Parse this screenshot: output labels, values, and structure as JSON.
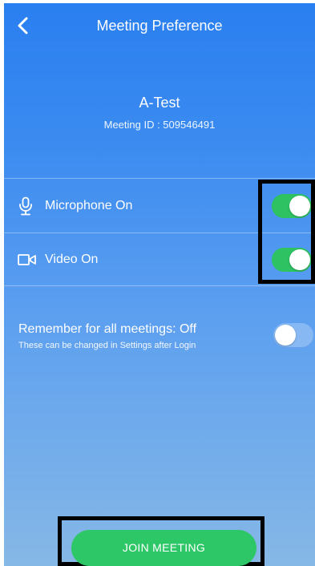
{
  "header": {
    "title": "Meeting Preference",
    "back_icon": "chevron-left-icon"
  },
  "meeting": {
    "name": "A-Test",
    "id_text": "Meeting ID : 509546491"
  },
  "options": [
    {
      "label": "Microphone On",
      "icon": "microphone-icon",
      "enabled": true
    },
    {
      "label": "Video On",
      "icon": "video-camera-icon",
      "enabled": true
    }
  ],
  "remember": {
    "title": "Remember for all meetings: Off",
    "subtitle": "These can be changed in Settings after Login",
    "enabled": false
  },
  "join_button": {
    "label": "JOIN MEETING"
  },
  "colors": {
    "gradient_top": "#2a7ff0",
    "gradient_bottom": "#86b8e6",
    "toggle_on": "#2ec262",
    "join_button": "#2ec767"
  }
}
